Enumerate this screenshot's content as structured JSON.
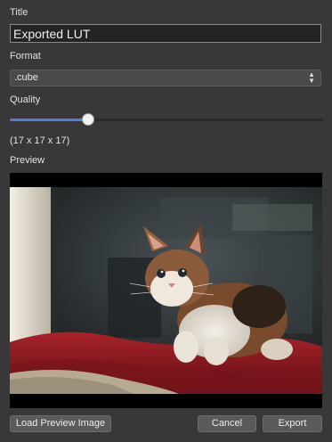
{
  "form": {
    "title_label": "Title",
    "title_value": "Exported LUT",
    "format_label": "Format",
    "format_value": ".cube",
    "quality_label": "Quality",
    "quality_fraction": 0.25,
    "quality_size": "(17 x 17 x 17)",
    "preview_label": "Preview"
  },
  "preview": {
    "subject": "kitten on red blanket"
  },
  "buttons": {
    "load_label": "Load Preview Image",
    "cancel_label": "Cancel",
    "export_label": "Export"
  },
  "colors": {
    "background": "#383838",
    "accent": "#4f7fd6"
  }
}
